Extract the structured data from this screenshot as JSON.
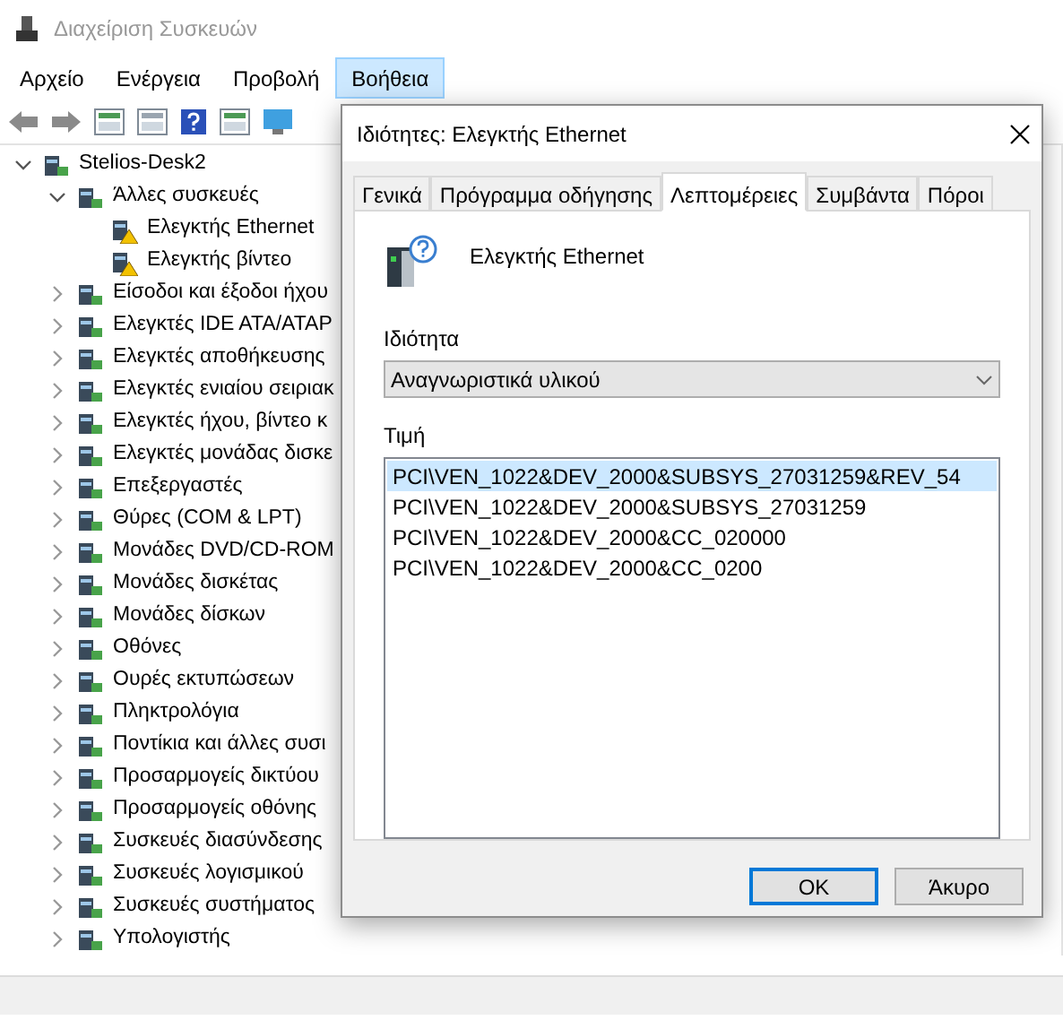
{
  "window": {
    "title": "Διαχείριση Συσκευών"
  },
  "menu": [
    {
      "label": "Αρχείο",
      "selected": false
    },
    {
      "label": "Ενέργεια",
      "selected": false
    },
    {
      "label": "Προβολή",
      "selected": false
    },
    {
      "label": "Βοήθεια",
      "selected": true
    }
  ],
  "tree": [
    {
      "label": "Stelios-Desk2",
      "expanded": true,
      "children": [
        {
          "label": "Άλλες συσκευές",
          "expanded": true,
          "children": [
            {
              "label": "Ελεγκτής Ethernet",
              "warning": true
            },
            {
              "label": "Ελεγκτής βίντεο",
              "warning": true
            }
          ]
        },
        {
          "label": "Είσοδοι και έξοδοι ήχου",
          "expanded": false
        },
        {
          "label": "Ελεγκτές IDE ATA/ATAP",
          "expanded": false
        },
        {
          "label": "Ελεγκτές αποθήκευσης",
          "expanded": false
        },
        {
          "label": "Ελεγκτές ενιαίου σειριακ",
          "expanded": false
        },
        {
          "label": "Ελεγκτές ήχου, βίντεο κ",
          "expanded": false
        },
        {
          "label": "Ελεγκτές μονάδας δισκε",
          "expanded": false
        },
        {
          "label": "Επεξεργαστές",
          "expanded": false
        },
        {
          "label": "Θύρες (COM & LPT)",
          "expanded": false
        },
        {
          "label": "Μονάδες DVD/CD-ROM",
          "expanded": false
        },
        {
          "label": "Μονάδες δισκέτας",
          "expanded": false
        },
        {
          "label": "Μονάδες δίσκων",
          "expanded": false
        },
        {
          "label": "Οθόνες",
          "expanded": false
        },
        {
          "label": "Ουρές εκτυπώσεων",
          "expanded": false
        },
        {
          "label": "Πληκτρολόγια",
          "expanded": false
        },
        {
          "label": "Ποντίκια και άλλες συσι",
          "expanded": false
        },
        {
          "label": "Προσαρμογείς δικτύου",
          "expanded": false
        },
        {
          "label": "Προσαρμογείς οθόνης",
          "expanded": false
        },
        {
          "label": "Συσκευές διασύνδεσης",
          "expanded": false
        },
        {
          "label": "Συσκευές λογισμικού",
          "expanded": false
        },
        {
          "label": "Συσκευές συστήματος",
          "expanded": false
        },
        {
          "label": "Υπολογιστής",
          "expanded": false
        }
      ]
    }
  ],
  "dialog": {
    "title": "Ιδιότητες: Ελεγκτής Ethernet",
    "tabs": [
      {
        "label": "Γενικά",
        "selected": false
      },
      {
        "label": "Πρόγραμμα οδήγησης",
        "selected": false
      },
      {
        "label": "Λεπτομέρειες",
        "selected": true
      },
      {
        "label": "Συμβάντα",
        "selected": false
      },
      {
        "label": "Πόροι",
        "selected": false
      }
    ],
    "device_name": "Ελεγκτής Ethernet",
    "property_label": "Ιδιότητα",
    "property_value": "Αναγνωριστικά υλικού",
    "value_label": "Τιμή",
    "values": [
      {
        "text": "PCI\\VEN_1022&DEV_2000&SUBSYS_27031259&REV_54",
        "selected": true
      },
      {
        "text": "PCI\\VEN_1022&DEV_2000&SUBSYS_27031259",
        "selected": false
      },
      {
        "text": "PCI\\VEN_1022&DEV_2000&CC_020000",
        "selected": false
      },
      {
        "text": "PCI\\VEN_1022&DEV_2000&CC_0200",
        "selected": false
      }
    ],
    "buttons": [
      {
        "label": "OK",
        "kind": "default"
      },
      {
        "label": "Άκυρο",
        "kind": "normal"
      }
    ]
  }
}
